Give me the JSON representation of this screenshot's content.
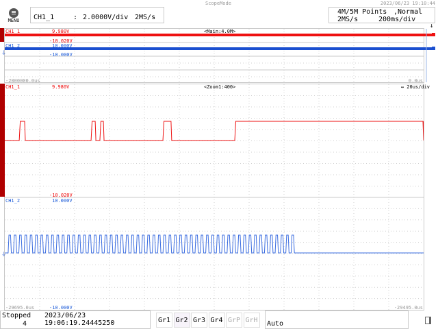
{
  "title_bar": {
    "mode": "ScopeMode",
    "datetime": "2023/06/23 19:10:44"
  },
  "menu": {
    "label": "MENU"
  },
  "channel_info": {
    "channel": "CH1_1",
    "separator": ":",
    "vdiv": "2.0000V/div",
    "rate": "2MS/s"
  },
  "acq_info": {
    "points": "4M/5M Points",
    "mode": ",Normal",
    "rate": "2MS/s",
    "tdiv": "200ms/div"
  },
  "main_panel": {
    "label": "<Main:4.0M>",
    "ch1": {
      "name": "CH1_1",
      "upper": "9.980V",
      "lower": "-10.020V"
    },
    "ch2": {
      "name": "CH1_2",
      "upper": "10.000V",
      "lower": "-10.000V"
    },
    "time_left": "-2000000.0us",
    "time_right": "0.0us"
  },
  "zoom_panel": {
    "label": "<Zoom1:400>",
    "tdiv": "20us/div",
    "ch1": {
      "name": "CH1_1",
      "upper": "9.980V",
      "lower": "-10.020V"
    },
    "ch2": {
      "name": "CH1_2",
      "upper": "10.000V",
      "lower": "-10.000V"
    },
    "time_left": "-29695.0us",
    "time_right": "-29495.0us"
  },
  "status": {
    "state": "Stopped",
    "count": "4",
    "timestamp": "2023/06/23 19:06:19.24445250"
  },
  "groups": [
    {
      "label": "Gr1",
      "enabled": true
    },
    {
      "label": "Gr2",
      "enabled": true,
      "selected": true
    },
    {
      "label": "Gr3",
      "enabled": true
    },
    {
      "label": "Gr4",
      "enabled": true
    },
    {
      "label": "GrP",
      "enabled": false
    },
    {
      "label": "GrH",
      "enabled": false
    }
  ],
  "trigger_mode": "Auto",
  "colors": {
    "ch1": "#ee1111",
    "ch2": "#1a4fd0",
    "ch1_marker": "#b00000"
  },
  "waveforms": {
    "time_range_us": [
      -29695.0,
      -29495.0
    ],
    "ch1_high_pulses_us": [
      [
        -29688.1,
        -29685.2
      ],
      [
        -29653.8,
        -29651.5
      ],
      [
        -29649.6,
        -29647.6
      ],
      [
        -29619.5,
        -29615.3
      ],
      [
        -29585.2,
        -29495.0
      ]
    ],
    "ch2_clock": {
      "start_us": -29693.4,
      "end_us": -29553.5,
      "period_us": 2.55
    }
  }
}
